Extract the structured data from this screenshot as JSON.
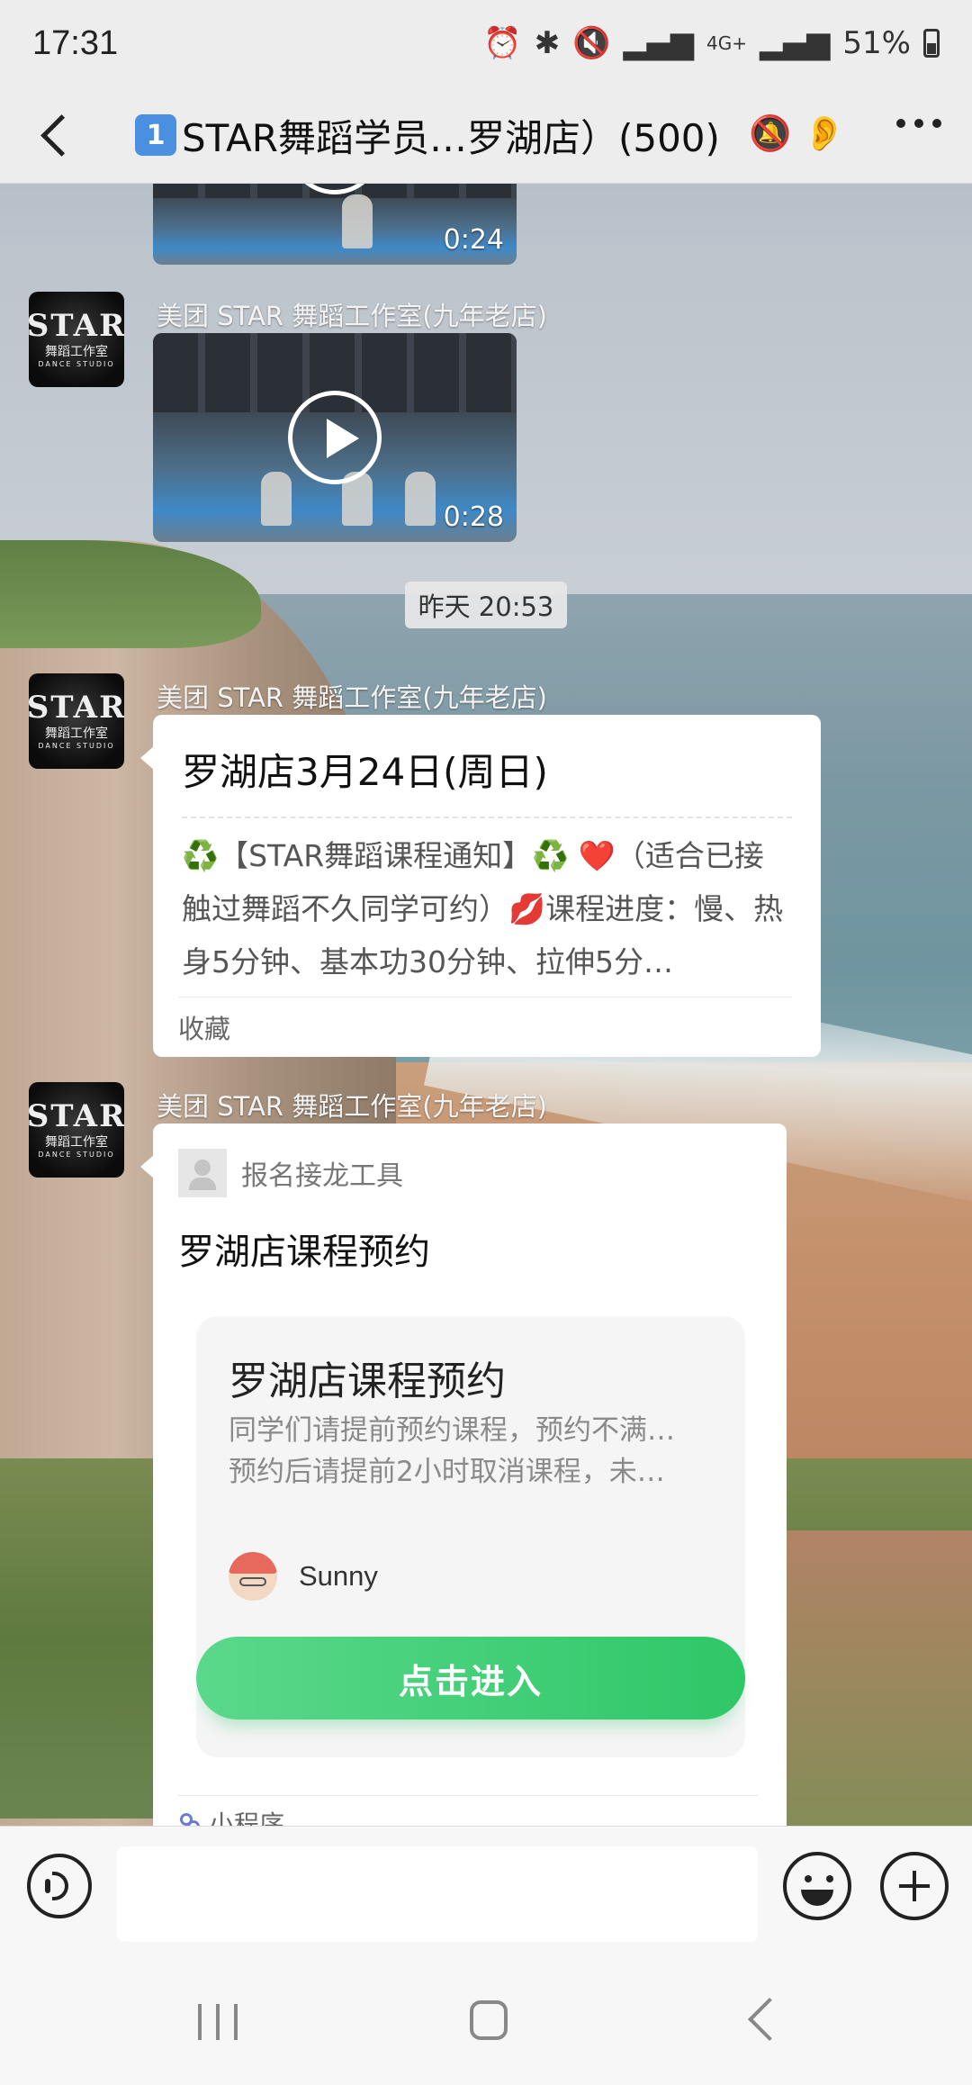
{
  "status_bar": {
    "time": "17:31",
    "network": "4G+",
    "battery": "51%"
  },
  "header": {
    "badge": "1",
    "title": "STAR舞蹈学员…罗湖店）(500)"
  },
  "messages": {
    "sender": "美团 STAR 舞蹈工作室(九年老店)",
    "avatar_text": {
      "line1": "STAR",
      "line2": "舞蹈工作室",
      "line3": "DANCE STUDIO"
    },
    "video1": {
      "duration": "0:24"
    },
    "video2": {
      "duration": "0:28"
    },
    "timestamp": "昨天 20:53",
    "card1": {
      "title": "罗湖店3月24日(周日)",
      "body_a": "♻️【STAR舞蹈课程通知】♻️ ❤️（适合已接触过舞蹈不久同学可约）💋课程进度：慢、热身5分钟、基本功30分钟、拉伸5分…",
      "footer": "收藏"
    },
    "card2": {
      "tool_label": "报名接龙工具",
      "title": "罗湖店课程预约",
      "inner_title": "罗湖店课程预约",
      "desc_line1": "同学们请提前预约课程，预约不满…",
      "desc_line2": "预约后请提前2小时取消课程，未…",
      "author": "Sunny",
      "button": "点击进入",
      "footer": "小程序"
    }
  },
  "input_bar": {
    "placeholder": ""
  }
}
